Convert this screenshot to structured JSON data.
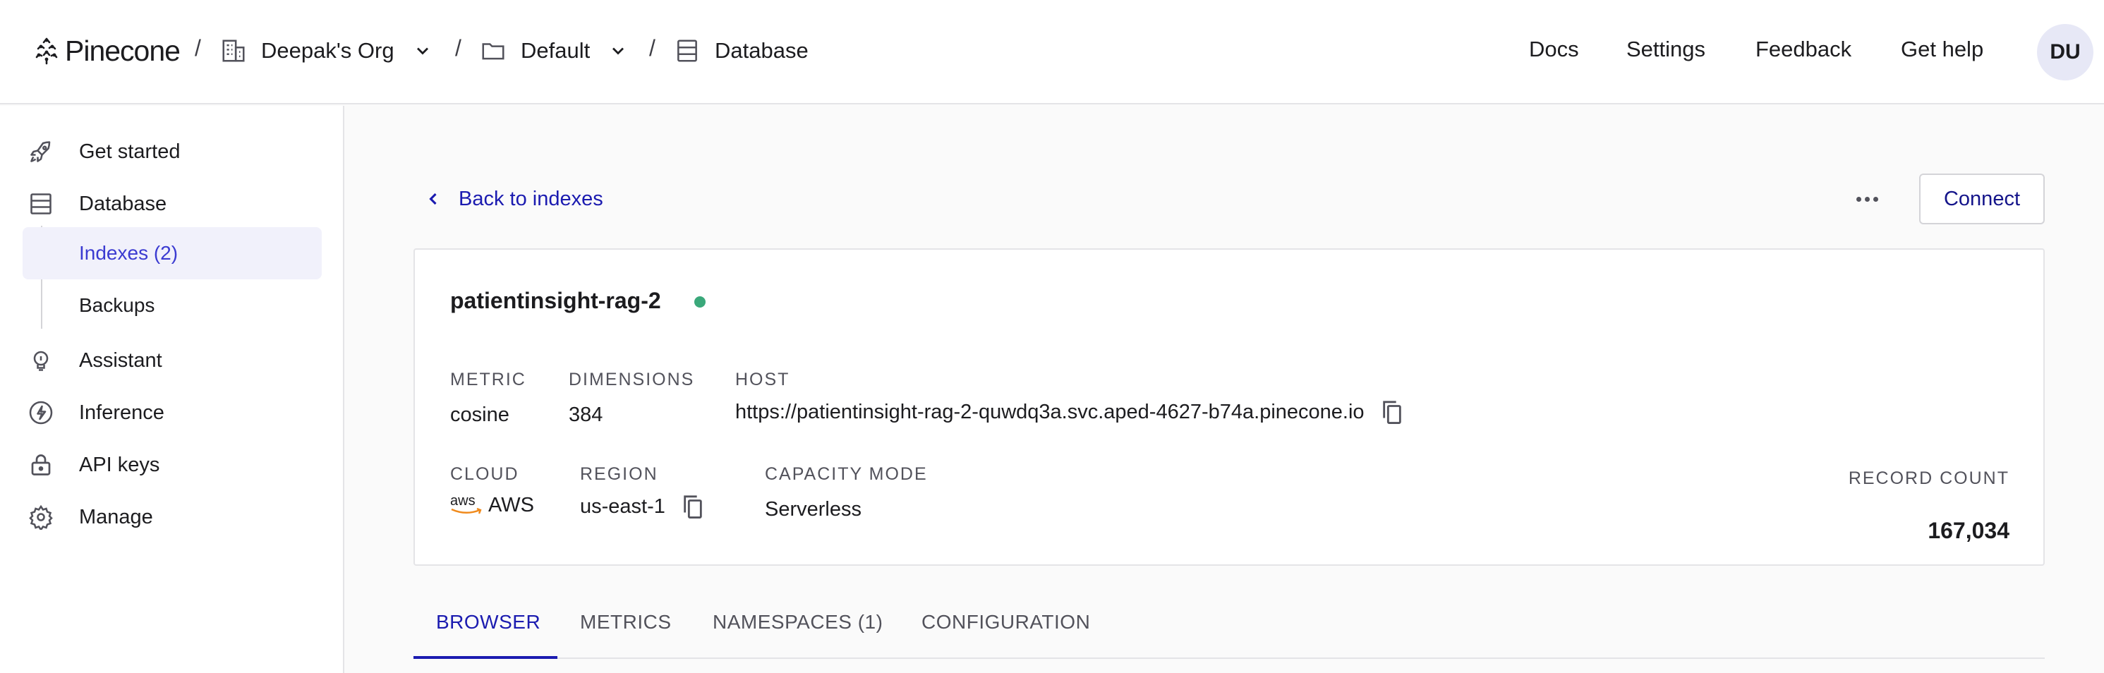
{
  "header": {
    "logo_text": "Pinecone",
    "breadcrumb": [
      {
        "label": "Deepak's Org",
        "icon": "building-icon",
        "has_dropdown": true
      },
      {
        "label": "Default",
        "icon": "folder-icon",
        "has_dropdown": true
      },
      {
        "label": "Database",
        "icon": "database-icon",
        "has_dropdown": false
      }
    ],
    "separator": "/",
    "nav": [
      "Docs",
      "Settings",
      "Feedback",
      "Get help"
    ],
    "avatar_initials": "DU"
  },
  "sidebar": {
    "items": [
      {
        "label": "Get started",
        "icon": "rocket-icon"
      },
      {
        "label": "Database",
        "icon": "database-icon"
      },
      {
        "label": "Assistant",
        "icon": "lightbulb-icon"
      },
      {
        "label": "Inference",
        "icon": "lightning-icon"
      },
      {
        "label": "API keys",
        "icon": "lock-icon"
      },
      {
        "label": "Manage",
        "icon": "gear-icon"
      }
    ],
    "sub_items": [
      {
        "label": "Indexes (2)",
        "active": true
      },
      {
        "label": "Backups",
        "active": false
      }
    ]
  },
  "toolbar": {
    "back_label": "Back to indexes",
    "connect_label": "Connect"
  },
  "index": {
    "name": "patientinsight-rag-2",
    "status_color": "#3aa87a",
    "metric_label": "METRIC",
    "metric": "cosine",
    "dimensions_label": "DIMENSIONS",
    "dimensions": "384",
    "host_label": "HOST",
    "host": "https://patientinsight-rag-2-quwdq3a.svc.aped-4627-b74a.pinecone.io",
    "cloud_label": "CLOUD",
    "cloud_logo_text": "aws",
    "cloud": "AWS",
    "region_label": "REGION",
    "region": "us-east-1",
    "capacity_label": "CAPACITY MODE",
    "capacity": "Serverless",
    "record_count_label": "RECORD COUNT",
    "record_count": "167,034"
  },
  "tabs": [
    {
      "label": "BROWSER",
      "active": true
    },
    {
      "label": "METRICS",
      "active": false
    },
    {
      "label": "NAMESPACES (1)",
      "active": false
    },
    {
      "label": "CONFIGURATION",
      "active": false
    }
  ],
  "colors": {
    "accent": "#1b1bb0",
    "active_bg": "#f1f1fb",
    "status_green": "#3aa87a"
  }
}
